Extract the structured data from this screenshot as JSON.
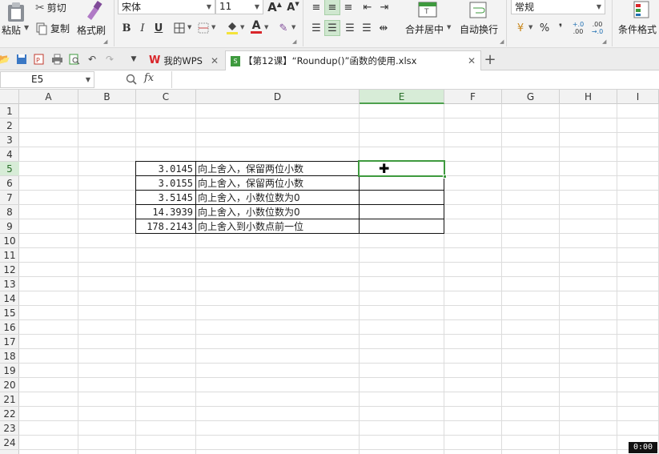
{
  "ribbon": {
    "paste_label": "粘贴",
    "cut_label": "剪切",
    "copy_label": "复制",
    "format_painter_label": "格式刷",
    "font_name": "宋体",
    "font_size": "11",
    "grow_font": "A",
    "shrink_font": "A",
    "bold": "B",
    "italic": "I",
    "underline": "U",
    "font_color_glyph": "A",
    "merge_center_label": "合并居中",
    "wrap_text_label": "自动换行",
    "number_format": "常规",
    "percent": "%",
    "comma": "❜",
    "inc_decimal": "+.0",
    "dec_decimal": ".00",
    "conditional_format_label": "条件格式"
  },
  "tabs": [
    {
      "label": "我的WPS",
      "icon": "wps-logo-icon"
    },
    {
      "label": "【第12课】“Roundup()”函数的使用.xlsx",
      "icon": "spreadsheet-file-icon"
    }
  ],
  "formula_bar": {
    "name_box": "E5",
    "fx_label": "fx",
    "formula": ""
  },
  "columns": [
    "A",
    "B",
    "C",
    "D",
    "E",
    "F",
    "G",
    "H",
    "I"
  ],
  "selected_column": "E",
  "rows": [
    "1",
    "2",
    "3",
    "4",
    "5",
    "6",
    "7",
    "8",
    "9",
    "10",
    "11",
    "12",
    "13",
    "14",
    "15",
    "16",
    "17",
    "18",
    "19",
    "20",
    "21",
    "22",
    "23",
    "24"
  ],
  "selected_row": "5",
  "table": [
    {
      "row": "5",
      "value": "3.0145",
      "note": "向上舍入，保留两位小数"
    },
    {
      "row": "6",
      "value": "3.0155",
      "note": "向上舍入，保留两位小数"
    },
    {
      "row": "7",
      "value": "3.5145",
      "note": "向上舍入，小数位数为0"
    },
    {
      "row": "8",
      "value": "14.3939",
      "note": "向上舍入，小数位数为0"
    },
    {
      "row": "9",
      "value": "178.2143",
      "note": "向上舍入到小数点前一位"
    }
  ],
  "active_cell": "E5",
  "timer": "0:00",
  "colors": {
    "accent_green": "#3e9a3e",
    "header_bg": "#f2f2f2",
    "selected_header_bg": "#d7ecd7"
  }
}
